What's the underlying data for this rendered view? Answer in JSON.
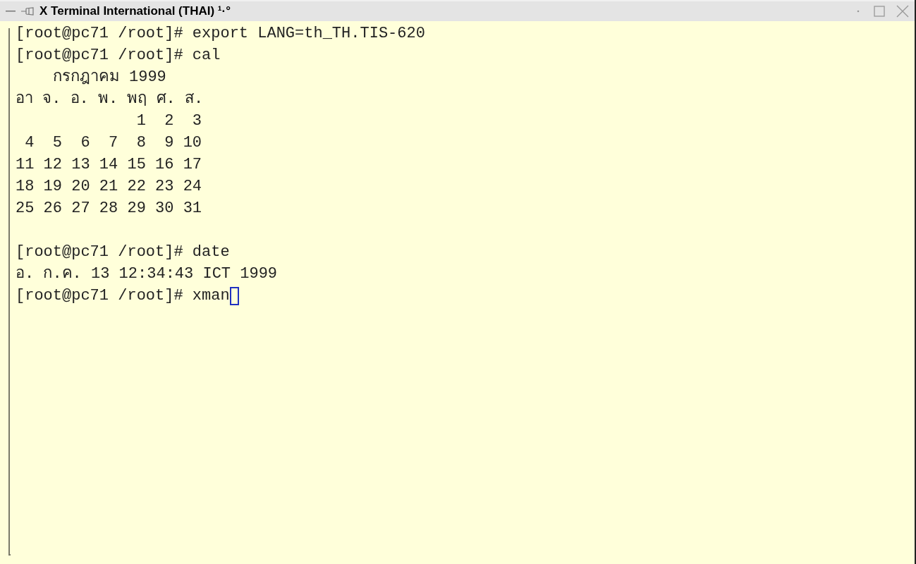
{
  "window": {
    "title": "X Terminal International (THAI) ¹·°"
  },
  "terminal": {
    "blocks": [
      [
        "[root@pc71 /root]# export LANG=th_TH.TIS-620",
        "[root@pc71 /root]# cal",
        "    กรกฎาคม 1999",
        "อา จ. อ. พ. พฤ ศ. ส.",
        "             1  2  3",
        " 4  5  6  7  8  9 10",
        "11 12 13 14 15 16 17",
        "18 19 20 21 22 23 24",
        "25 26 27 28 29 30 31"
      ],
      [
        "[root@pc71 /root]# date",
        "อ. ก.ค. 13 12:34:43 ICT 1999",
        "[root@pc71 /root]# xman"
      ]
    ]
  }
}
